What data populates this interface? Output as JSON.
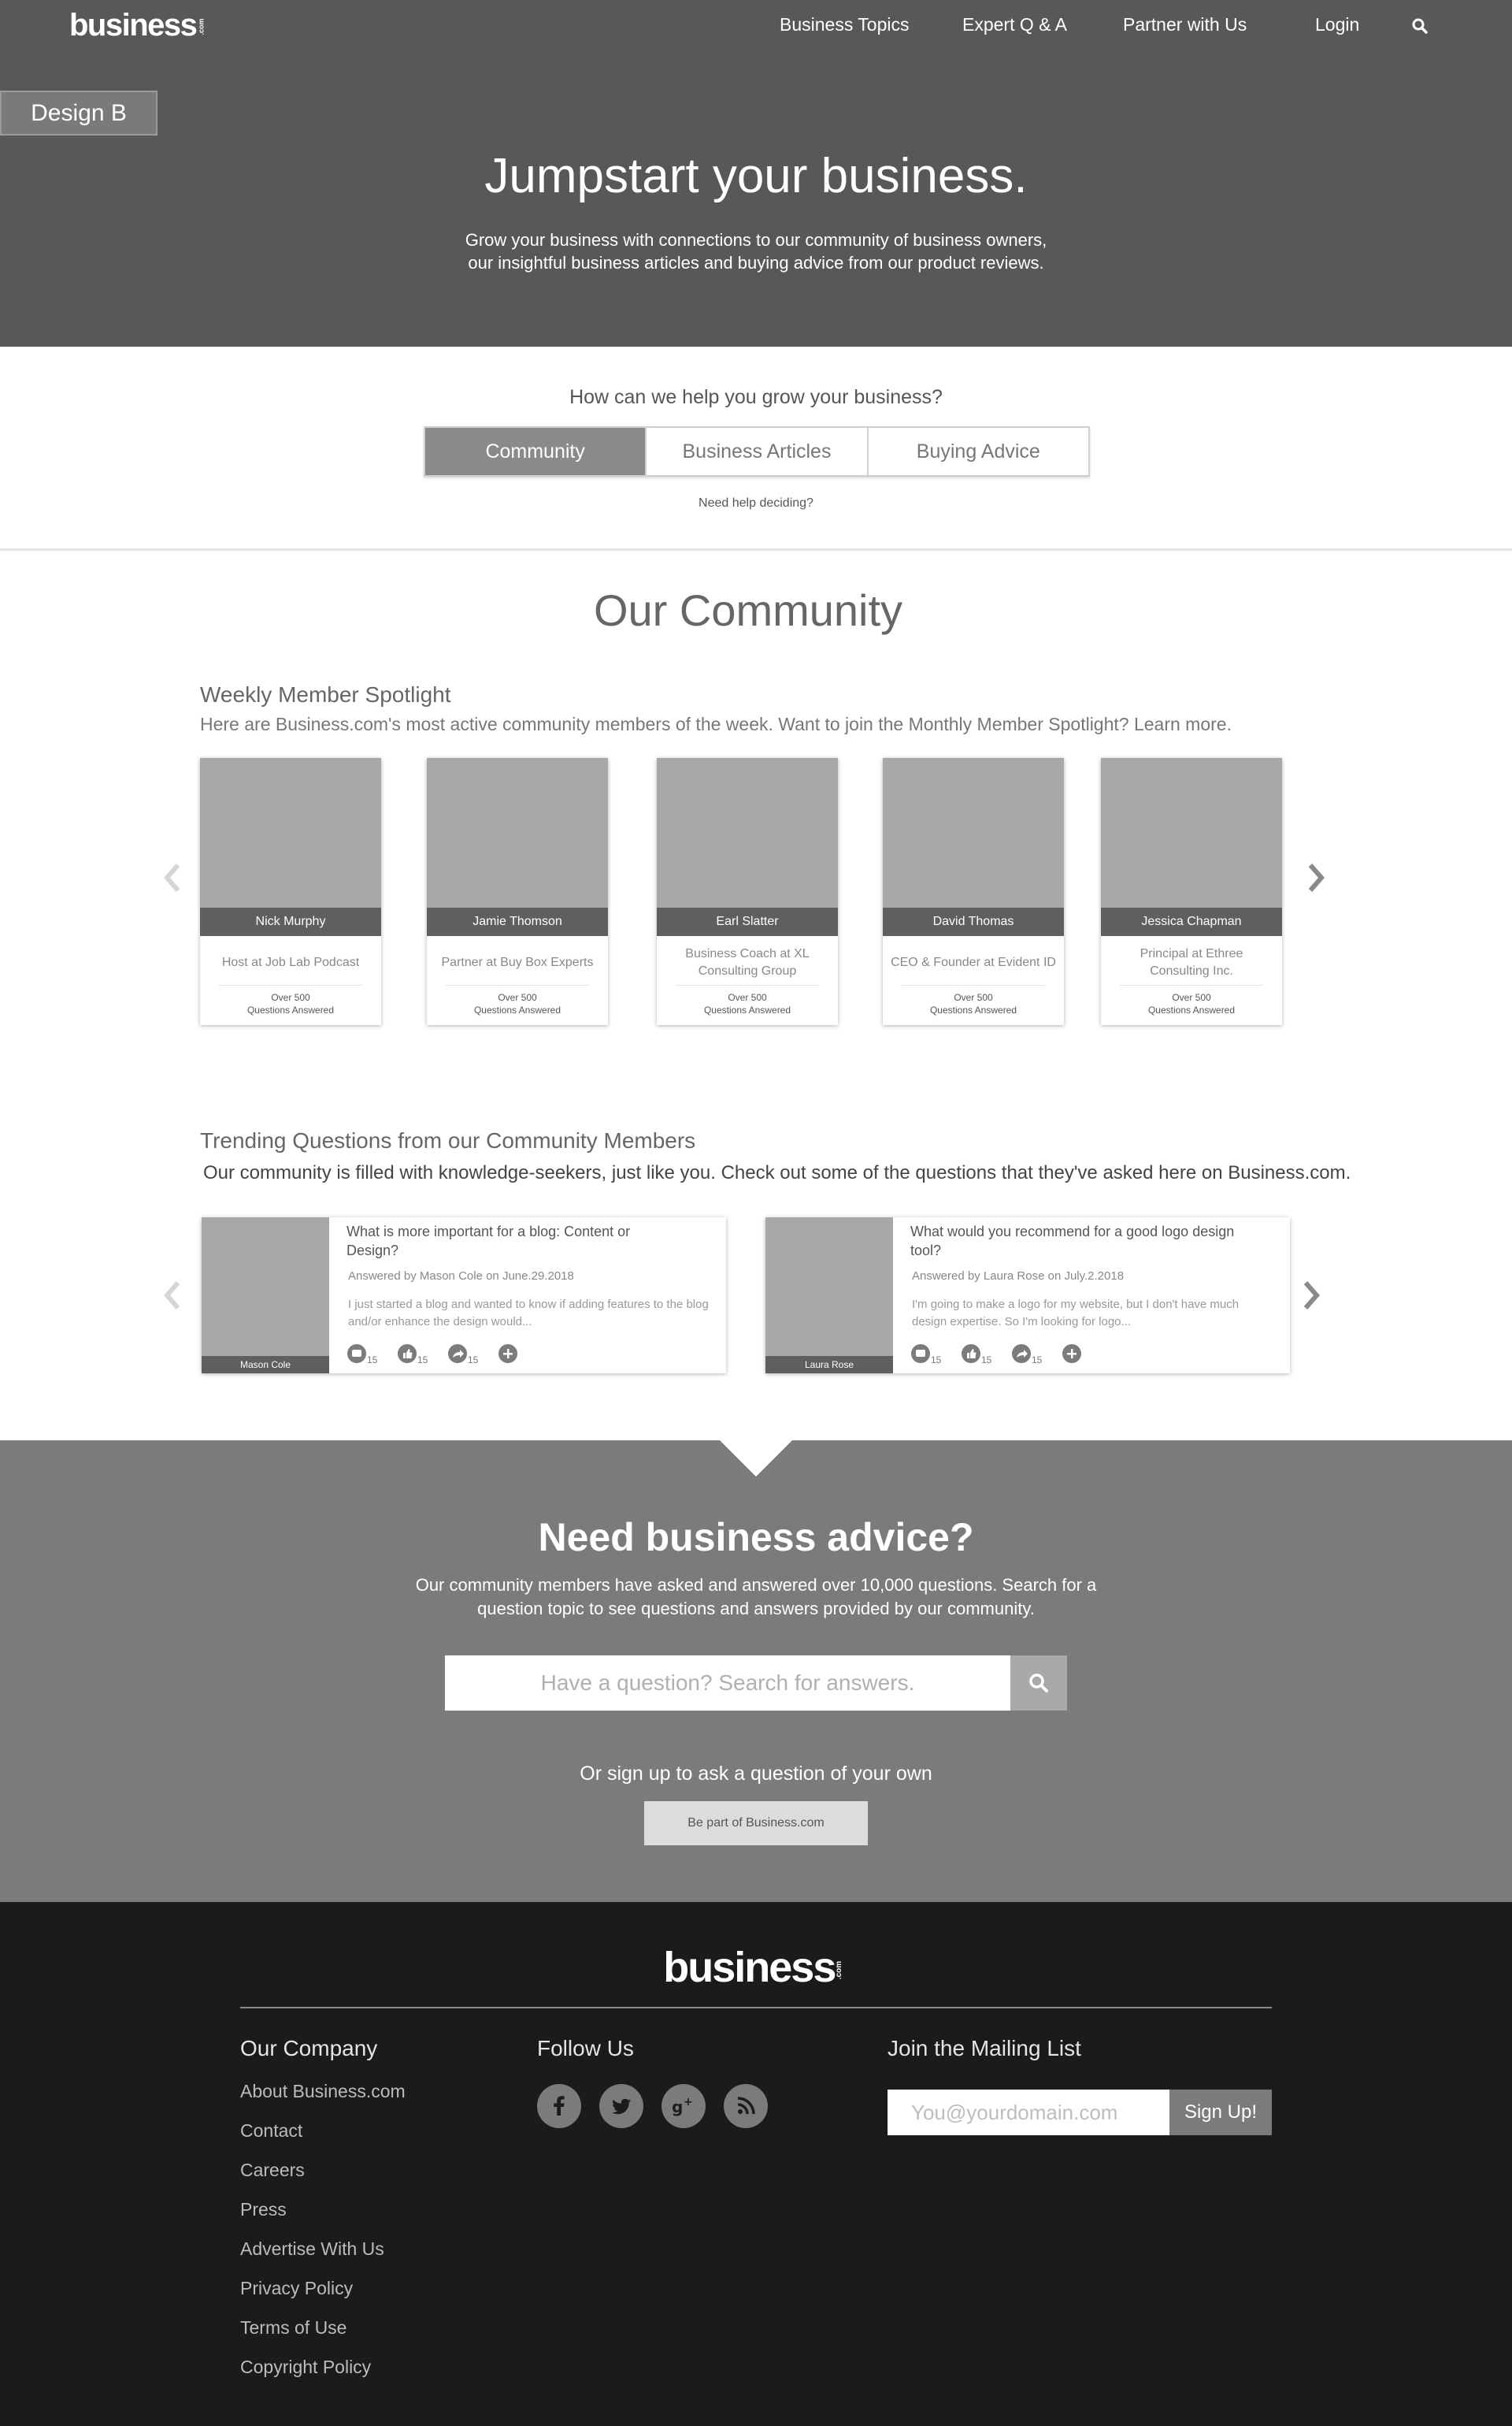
{
  "header": {
    "logo": "business",
    "logo_suffix": ".com",
    "nav": [
      "Business Topics",
      "Expert Q & A",
      "Partner with Us",
      "Login"
    ],
    "design_tag": "Design B"
  },
  "hero": {
    "title": "Jumpstart your business.",
    "subtitle_line1": "Grow your business with connections to our community of business owners,",
    "subtitle_line2": "our insightful business articles and buying advice from our product reviews."
  },
  "help": {
    "question": "How can we help you grow your business?",
    "tabs": [
      "Community",
      "Business Articles",
      "Buying Advice"
    ],
    "active_tab": "Community",
    "help_link": "Need help deciding?"
  },
  "community": {
    "title": "Our Community",
    "spotlight_title": "Weekly Member Spotlight",
    "spotlight_desc": "Here are Business.com's most active community members of the week. Want to join the Monthly Member Spotlight? Learn more.",
    "members": [
      {
        "name": "Nick Murphy",
        "role": "Host at Job Lab Podcast",
        "stat_line1": "Over 500",
        "stat_line2": "Questions Answered"
      },
      {
        "name": "Jamie Thomson",
        "role": "Partner at Buy Box Experts",
        "stat_line1": "Over 500",
        "stat_line2": "Questions Answered"
      },
      {
        "name": "Earl Slatter",
        "role": "Business Coach at XL Consulting Group",
        "stat_line1": "Over 500",
        "stat_line2": "Questions Answered"
      },
      {
        "name": "David Thomas",
        "role": "CEO & Founder at Evident ID",
        "stat_line1": "Over 500",
        "stat_line2": "Questions Answered"
      },
      {
        "name": "Jessica Chapman",
        "role": "Principal at Ethree Consulting Inc.",
        "stat_line1": "Over 500",
        "stat_line2": "Questions Answered"
      }
    ]
  },
  "trending": {
    "title": "Trending Questions from our Community Members",
    "desc": "Our community is filled with knowledge-seekers, just like you. Check out some of the questions that they've asked here on Business.com.",
    "questions": [
      {
        "author": "Mason Cole",
        "title": "What is more important for a blog: Content or Design?",
        "meta": "Answered by Mason Cole on June.29.2018",
        "excerpt": "I just started a blog and wanted to know if adding features to the blog and/or enhance the design would...",
        "counts": [
          "15",
          "15",
          "15"
        ]
      },
      {
        "author": "Laura Rose",
        "title": "What would you recommend for a good logo design tool?",
        "meta": "Answered by Laura Rose on July.2.2018",
        "excerpt": "I'm going to make a logo for my website, but I don't have much design expertise. So I'm looking for logo...",
        "counts": [
          "15",
          "15",
          "15"
        ]
      }
    ]
  },
  "advice": {
    "title": "Need business advice?",
    "sub_line1": "Our community members have asked and answered over 10,000 questions. Search for a",
    "sub_line2": "question topic to see questions and answers provided by our community.",
    "search_placeholder": "Have a question? Search for answers.",
    "signup_prompt": "Or sign up to ask a question of your own",
    "join_button": "Be part of Business.com"
  },
  "footer": {
    "logo": "business",
    "logo_suffix": ".com",
    "company_heading": "Our Company",
    "company_links": [
      "About Business.com",
      "Contact",
      "Careers",
      "Press",
      "Advertise With Us",
      "Privacy Policy",
      "Terms of Use",
      "Copyright Policy"
    ],
    "follow_heading": "Follow Us",
    "social_icons": [
      "facebook-icon",
      "twitter-icon",
      "google-plus-icon",
      "rss-icon"
    ],
    "mailing_heading": "Join the Mailing List",
    "mailing_placeholder": "You@yourdomain.com",
    "signup_button": "Sign Up!"
  },
  "colors": {
    "hero_bg": "#585858",
    "advice_bg": "#7b7b7b",
    "footer_bg": "#1b1b1b",
    "active_tab": "#8a8a8a"
  }
}
